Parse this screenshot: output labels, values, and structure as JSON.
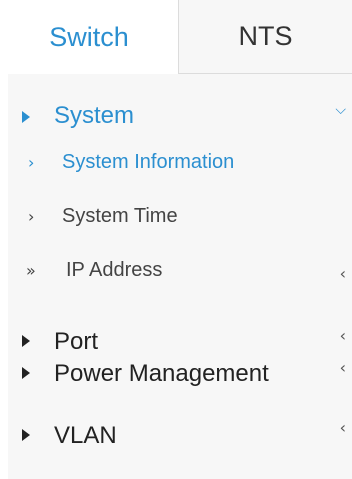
{
  "tabs": [
    {
      "label": "Switch",
      "active": true
    },
    {
      "label": "NTS",
      "active": false
    }
  ],
  "menu": {
    "system": {
      "label": "System",
      "expanded": true
    },
    "system_children": [
      {
        "label": "System Information",
        "active": true
      },
      {
        "label": "System Time",
        "active": false
      },
      {
        "label": "IP Address",
        "active": false
      }
    ],
    "port": {
      "label": "Port"
    },
    "power": {
      "label": "Power Management"
    },
    "vlan": {
      "label": "VLAN"
    }
  },
  "colors": {
    "accent": "#2b8fd0",
    "panel_bg": "#f7f7f7",
    "text": "#222222"
  },
  "icons": {
    "expand": "triangle-right-icon",
    "child": "chevron-right-icon",
    "child_expandable": "double-chevron-right-icon",
    "expanded": "chevron-down-icon",
    "collapsed": "chevron-left-icon"
  }
}
